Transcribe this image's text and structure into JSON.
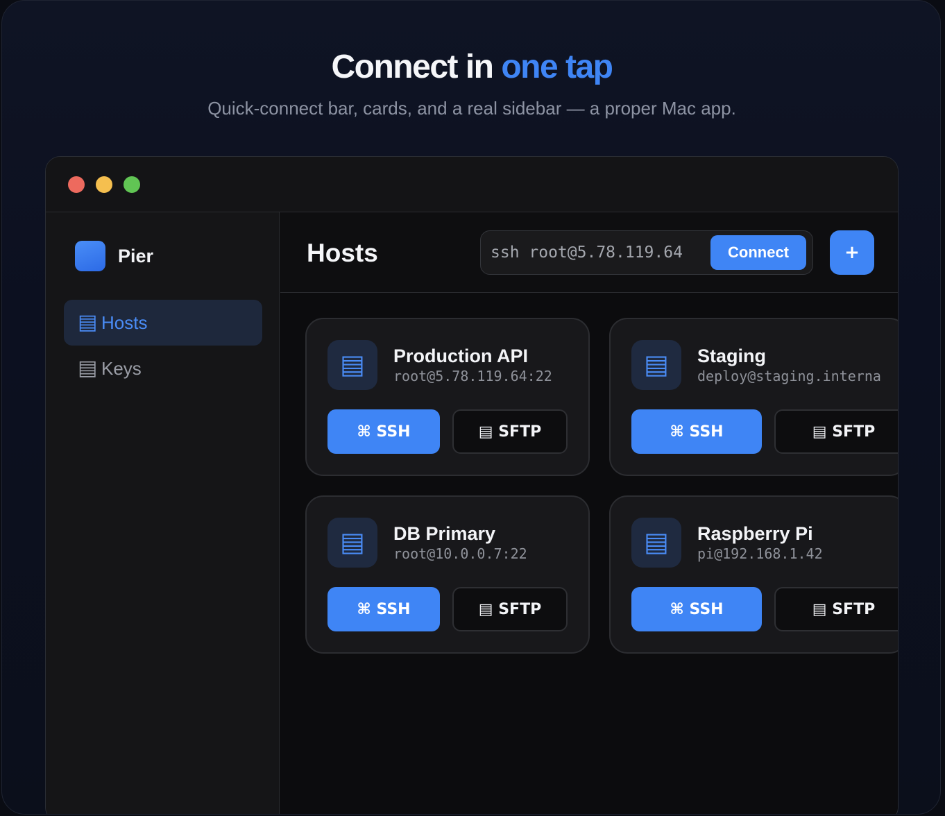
{
  "hero": {
    "title_main": "Connect in ",
    "title_accent": "one tap",
    "subtitle": "Quick-connect bar, cards, and a real sidebar — a proper Mac app."
  },
  "colors": {
    "accent": "#3f85f5",
    "traffic_red": "#ed6a5e",
    "traffic_yellow": "#f5bf4f",
    "traffic_green": "#61c554"
  },
  "sidebar": {
    "app_name": "Pier",
    "items": [
      {
        "label": "Hosts",
        "icon": "server-icon",
        "glyph": "▤"
      },
      {
        "label": "Keys",
        "icon": "key-list-icon",
        "glyph": "▤"
      }
    ]
  },
  "toolbar": {
    "title": "Hosts",
    "quick_connect_value": "ssh root@5.78.119.64",
    "connect_label": "Connect",
    "add_label": "+"
  },
  "hosts": [
    {
      "name": "Production API",
      "address": "root@5.78.119.64:22",
      "ssh_label": "⌘ SSH",
      "sftp_label": "▤ SFTP",
      "icon_glyph": "▤"
    },
    {
      "name": "Staging",
      "address": "deploy@staging.interna",
      "ssh_label": "⌘ SSH",
      "sftp_label": "▤ SFTP",
      "icon_glyph": "▤"
    },
    {
      "name": "DB Primary",
      "address": "root@10.0.0.7:22",
      "ssh_label": "⌘ SSH",
      "sftp_label": "▤ SFTP",
      "icon_glyph": "▤"
    },
    {
      "name": "Raspberry Pi",
      "address": "pi@192.168.1.42",
      "ssh_label": "⌘ SSH",
      "sftp_label": "▤ SFTP",
      "icon_glyph": "▤"
    }
  ]
}
